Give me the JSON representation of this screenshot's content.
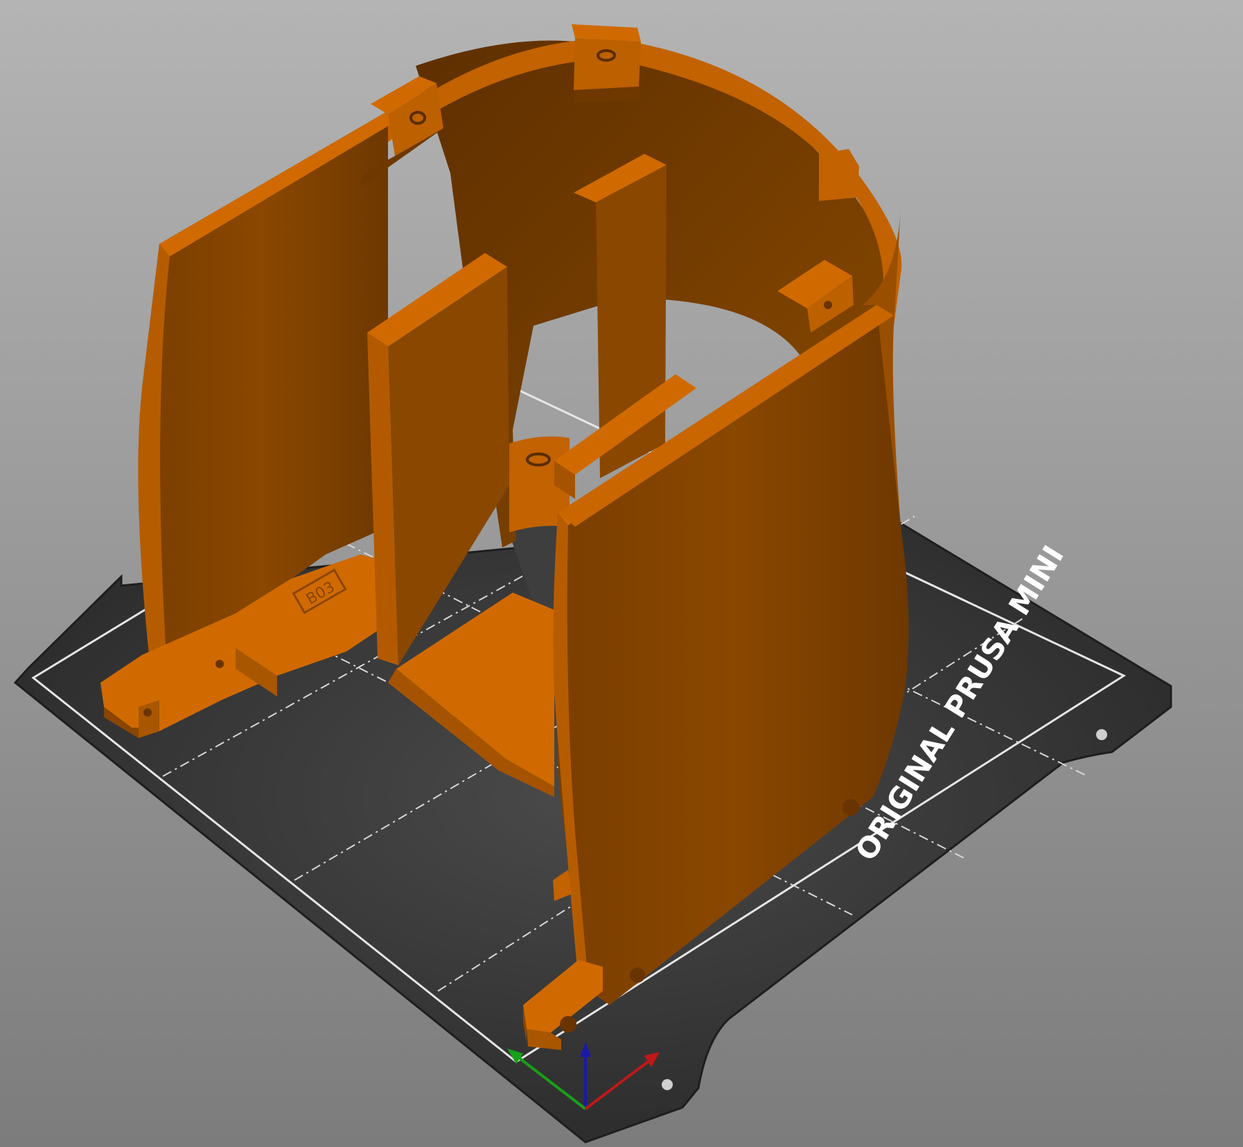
{
  "viewport": {
    "background_top": "#b4b4b4",
    "background_bottom": "#7c7c7c"
  },
  "bed": {
    "brand_label": "ORIGINAL PRUSA MINI",
    "plate_color": "#2f2f2f",
    "grid_color": "#d8d8d8",
    "label_color": "#ffffff"
  },
  "model": {
    "embossed_label": "B03",
    "color_light": "#d06a00",
    "color_mid": "#a55300",
    "color_dark": "#743a00"
  },
  "axes": {
    "x_color": "#c01818",
    "y_color": "#18a018",
    "z_color": "#1a1aa8"
  }
}
